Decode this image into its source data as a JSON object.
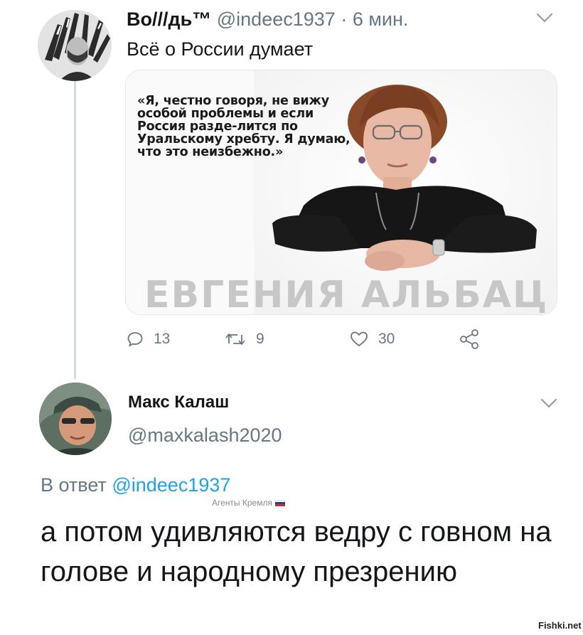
{
  "tweet1": {
    "display_name": "Во///дь™",
    "handle": "@indeec1937",
    "separator": "·",
    "time": "6 мин.",
    "text": "Всё о России думает",
    "media": {
      "quote": "«Я, честно говоря, не вижу особой проблемы и если Россия разде-лится по Уральскому хребту. Я думаю, что это неизбежно.»",
      "caption": "ЕВГЕНИЯ АЛЬБАЦ"
    },
    "actions": {
      "reply_count": "13",
      "retweet_count": "9",
      "like_count": "30"
    }
  },
  "tweet2": {
    "display_name": "Макс Калаш",
    "handle": "@maxkalash2020",
    "reply_prefix": "В ответ",
    "reply_to": "@indeec1937",
    "badge": "Агенты Кремля",
    "text": "а потом удивляются ведру с говном на голове и народному презрению"
  },
  "watermark": "Fishki.net",
  "colors": {
    "accent": "#1da1f2",
    "secondary_text": "#657786",
    "thread_line": "#cfd9de"
  },
  "icons": [
    "reply-icon",
    "retweet-icon",
    "like-icon",
    "share-icon",
    "chevron-down-icon"
  ]
}
